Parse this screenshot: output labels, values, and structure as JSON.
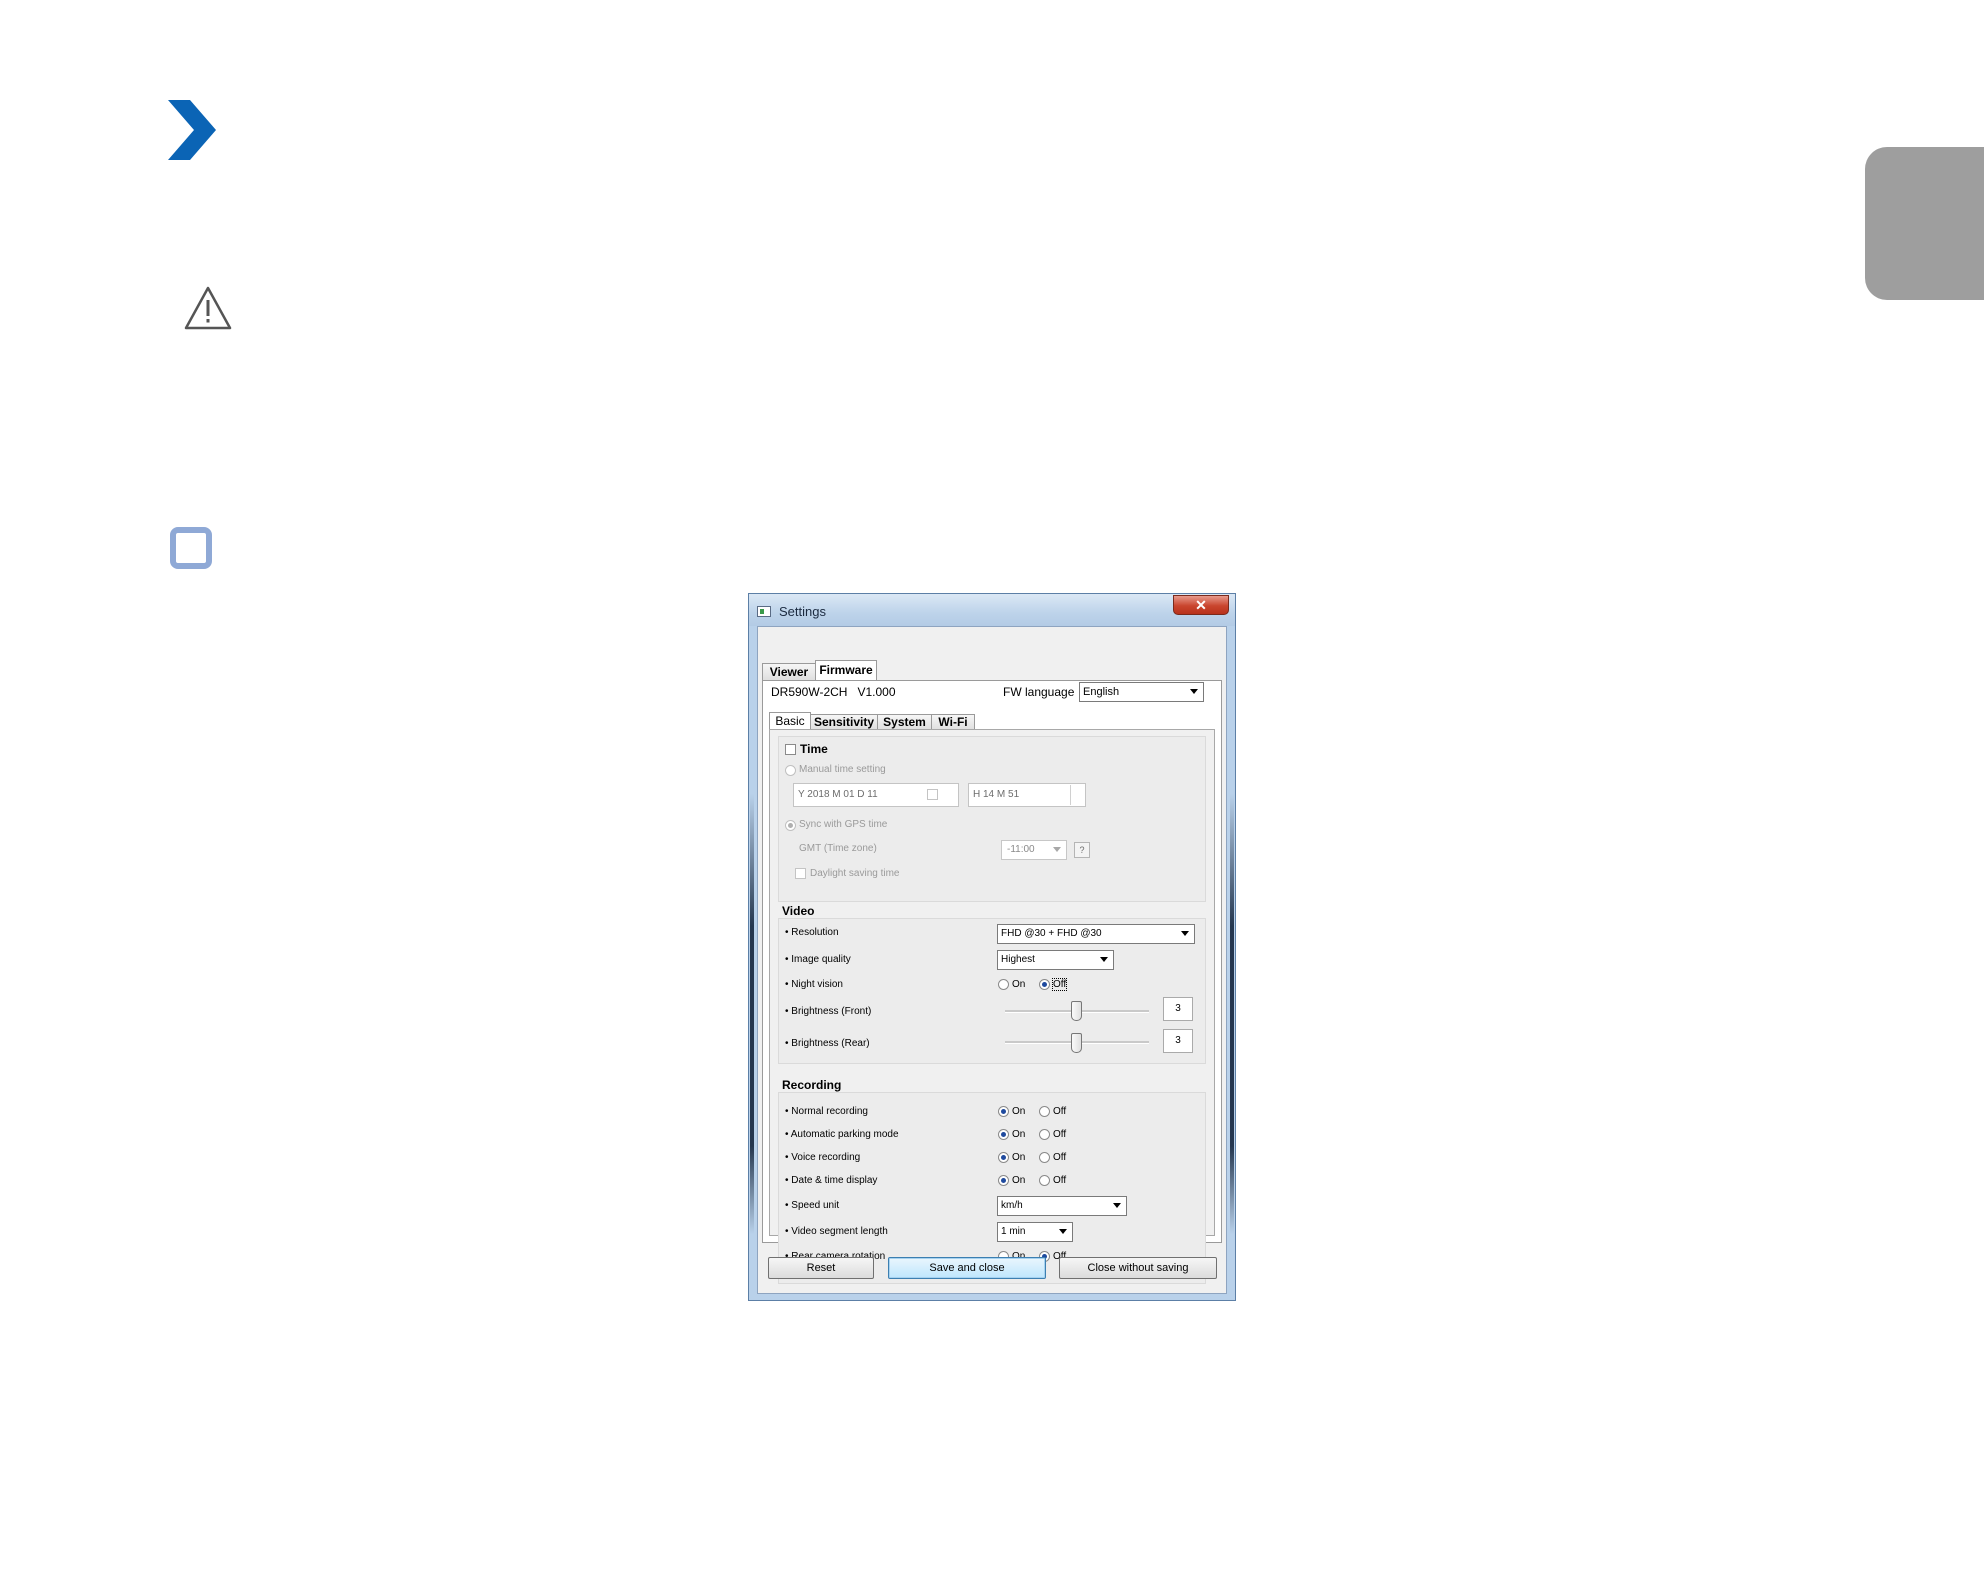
{
  "page": {
    "accent_color": "#0b64b5",
    "side_tab_color": "#9e9e9e",
    "icons": [
      "chevron-right-icon",
      "warning-triangle-icon",
      "square-outline-icon"
    ]
  },
  "window": {
    "title": "Settings",
    "close_glyph": "✕",
    "top_tabs": [
      "Viewer",
      "Firmware"
    ],
    "active_top_tab": "Firmware",
    "device_model": "DR590W-2CH",
    "device_version": "V1.000",
    "fw_language_label": "FW language",
    "fw_language_value": "English",
    "sub_tabs": [
      "Basic",
      "Sensitivity",
      "System",
      "Wi-Fi"
    ],
    "active_sub_tab": "Basic"
  },
  "time": {
    "title": "Time",
    "enabled": false,
    "manual_label": "Manual time setting",
    "date_value": "Y 2018 M 01 D 11",
    "time_value": "H 14 M 51",
    "gps_label": "Sync with GPS time",
    "gmt_label": "GMT (Time zone)",
    "gmt_value": "-11:00",
    "help_label": "?",
    "dst_label": "Daylight saving time"
  },
  "video": {
    "title": "Video",
    "resolution_label": "• Resolution",
    "resolution_value": "FHD @30 + FHD @30",
    "image_quality_label": "• Image quality",
    "image_quality_value": "Highest",
    "night_vision_label": "• Night vision",
    "night_vision_value": "Off",
    "brightness_front_label": "• Brightness (Front)",
    "brightness_front_value": "3",
    "brightness_rear_label": "• Brightness (Rear)",
    "brightness_rear_value": "3",
    "on_label": "On",
    "off_label": "Off"
  },
  "recording": {
    "title": "Recording",
    "normal_label": "• Normal recording",
    "normal_value": "On",
    "parking_label": "• Automatic parking mode",
    "parking_value": "On",
    "voice_label": "• Voice recording",
    "voice_value": "On",
    "datetime_label": "• Date & time display",
    "datetime_value": "On",
    "speed_unit_label": "• Speed unit",
    "speed_unit_value": "km/h",
    "segment_label": "• Video segment length",
    "segment_value": "1 min",
    "rotation_label": "• Rear camera rotation",
    "rotation_value": "Off",
    "on_label": "On",
    "off_label": "Off"
  },
  "buttons": {
    "reset": "Reset",
    "save": "Save and close",
    "close": "Close without saving"
  }
}
